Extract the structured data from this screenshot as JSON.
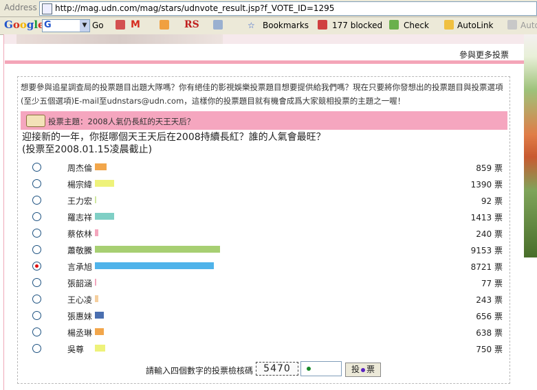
{
  "address_bar": {
    "label": "Address",
    "url": "http://mag.udn.com/mag/stars/udnvote_result.jsp?f_VOTE_ID=1295"
  },
  "toolbar": {
    "google_logo": "Google",
    "go": "Go",
    "rs": "RS",
    "bookmarks": "Bookmarks",
    "blocked": "177 blocked",
    "check": "Check",
    "autolink": "AutoLink",
    "autofill": "AutoFill"
  },
  "page": {
    "more_votes": "參與更多投票",
    "intro": "想要參與追星調查局的投票題目出題大隊嗎？你有絕佳的影視娛樂投票題目想要提供給我們嗎？現在只要將你發想出的投票題目與投票選項(至少五個選項)E-mail至udnstars@udn.com，這樣你的投票題目就有機會成爲大家競相投票的主題之一喔！",
    "theme": "投票主題：2008人氣仍長紅的天王天后？",
    "question_line1": "迎接新的一年，你挺哪個天王天后在2008持續長紅？誰的人氣會最旺？",
    "question_line2": "(投票至2008.01.15凌晨截止)",
    "verify_label": "請輸入四個數字的投票檢核碼",
    "captcha": "5470",
    "vote_button_left": "投",
    "vote_button_right": "票"
  },
  "colors": {
    "pink_bar": "#f4a5b8",
    "theme_bg": "#f5a6bf"
  },
  "chart_data": {
    "type": "bar",
    "categories": [
      "周杰倫",
      "楊宗緯",
      "王力宏",
      "羅志祥",
      "蔡依林",
      "蕭敬騰",
      "言承旭",
      "張韶涵",
      "王心凌",
      "張惠妹",
      "楊丞琳",
      "吳尊"
    ],
    "values": [
      859,
      1390,
      92,
      1413,
      240,
      9153,
      8721,
      77,
      243,
      656,
      638,
      750
    ],
    "labels": [
      "859 票",
      "1390 票",
      "92 票",
      "1413 票",
      "240 票",
      "9153 票",
      "8721 票",
      "77 票",
      "243 票",
      "656 票",
      "638 票",
      "750 票"
    ],
    "colors": [
      "#f2a64b",
      "#eef27a",
      "#cfe7a0",
      "#7fcfc5",
      "#f4a6bd",
      "#a7cf72",
      "#4fb3ea",
      "#f2a6bd",
      "#f5cf9e",
      "#4a6fb0",
      "#f2a64b",
      "#eef27a"
    ],
    "selected_index": 6
  }
}
